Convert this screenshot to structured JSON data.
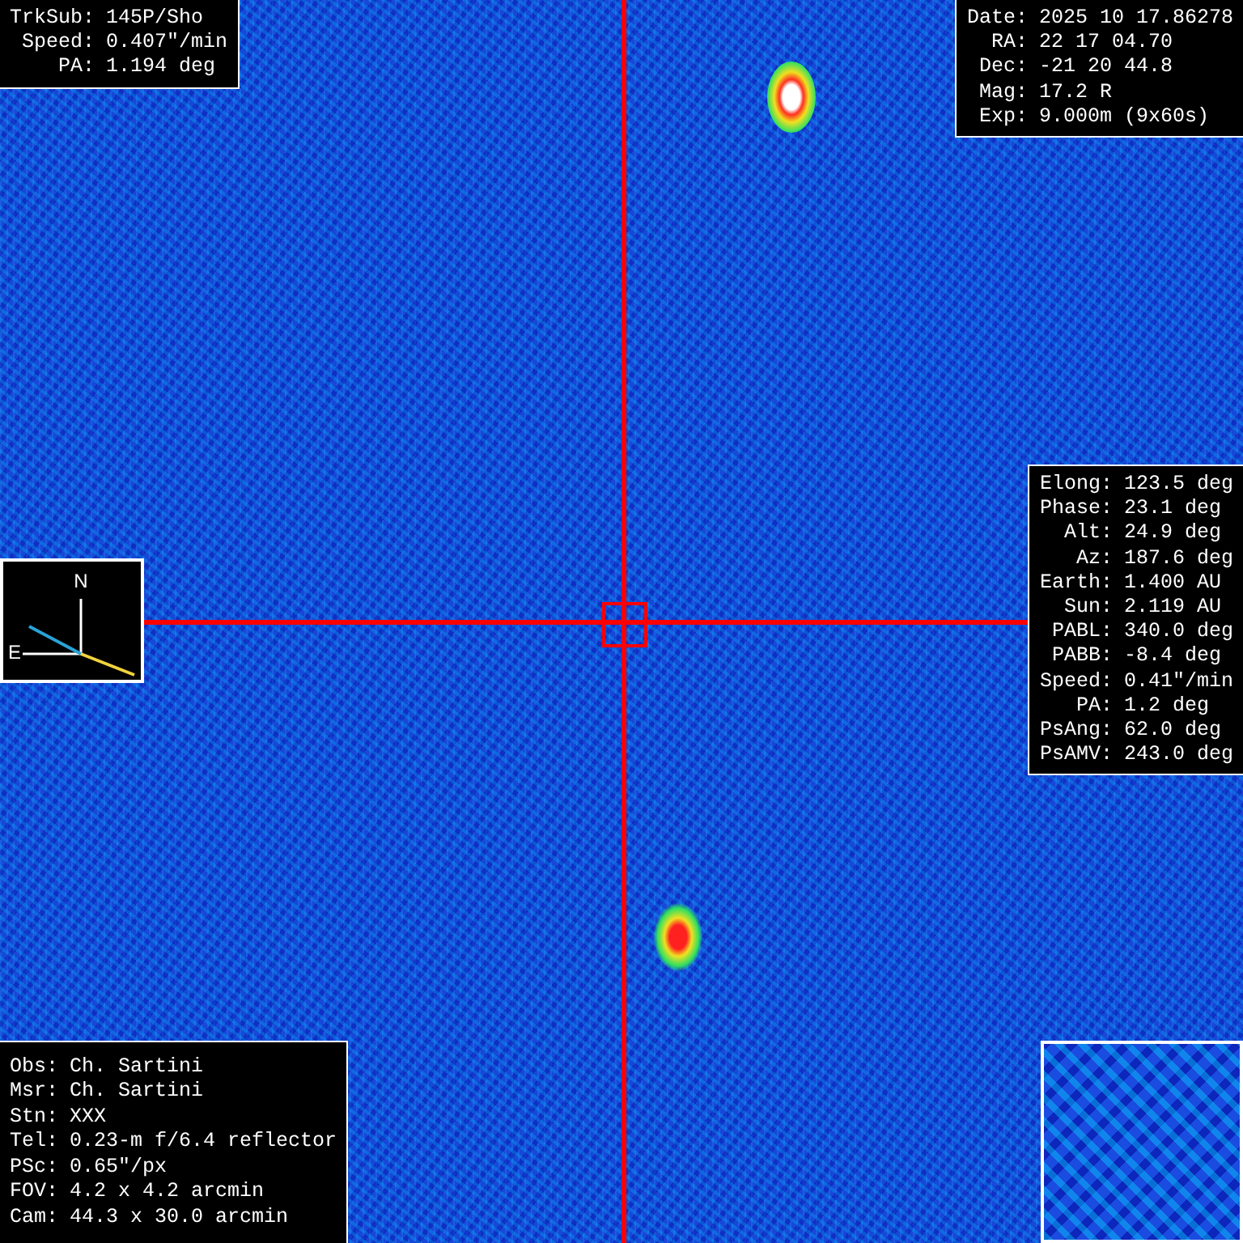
{
  "tracking": [
    {
      "label": "TrkSub:",
      "value": "145P/Sho"
    },
    {
      "label": "Speed:",
      "value": "0.407\"/min"
    },
    {
      "label": "PA:",
      "value": "1.194 deg"
    }
  ],
  "target": [
    {
      "label": "Date:",
      "value": "2025 10 17.86278"
    },
    {
      "label": "RA:",
      "value": "22 17 04.70"
    },
    {
      "label": "Dec:",
      "value": "-21 20 44.8"
    },
    {
      "label": "Mag:",
      "value": "17.2 R"
    },
    {
      "label": "Exp:",
      "value": "9.000m (9x60s)"
    }
  ],
  "geometry": [
    {
      "label": "Elong:",
      "value": "123.5 deg"
    },
    {
      "label": "Phase:",
      "value": "23.1 deg"
    },
    {
      "label": "Alt:",
      "value": "24.9 deg"
    },
    {
      "label": "Az:",
      "value": "187.6 deg"
    },
    {
      "label": "Earth:",
      "value": "1.400 AU"
    },
    {
      "label": "Sun:",
      "value": "2.119 AU"
    },
    {
      "label": "PABL:",
      "value": "340.0 deg"
    },
    {
      "label": "PABB:",
      "value": "-8.4 deg"
    },
    {
      "label": "Speed:",
      "value": "0.41\"/min"
    },
    {
      "label": "PA:",
      "value": "1.2 deg"
    },
    {
      "label": "PsAng:",
      "value": "62.0 deg"
    },
    {
      "label": "PsAMV:",
      "value": "243.0 deg"
    }
  ],
  "compass": {
    "north": "N",
    "east": "E"
  },
  "observer": [
    {
      "label": "Obs:",
      "value": "Ch. Sartini"
    },
    {
      "label": "Msr:",
      "value": "Ch. Sartini"
    },
    {
      "label": "Stn:",
      "value": "XXX"
    },
    {
      "label": "Tel:",
      "value": "0.23-m f/6.4 reflector"
    },
    {
      "label": "PSc:",
      "value": "0.65\"/px"
    },
    {
      "label": "FOV:",
      "value": "4.2 x 4.2 arcmin"
    },
    {
      "label": "Cam:",
      "value": "44.3 x 30.0 arcmin"
    }
  ]
}
